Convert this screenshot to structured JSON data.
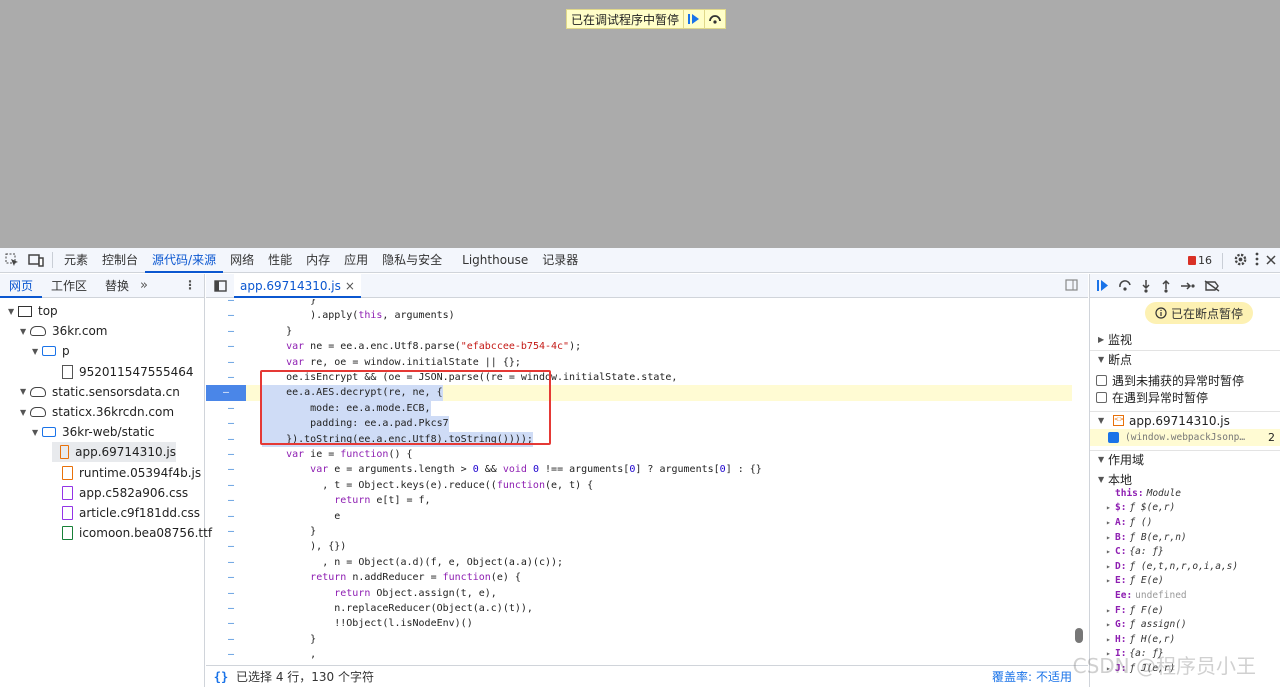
{
  "banner": {
    "text": "已在调试程序中暂停"
  },
  "toolbar": {
    "tabs": [
      "元素",
      "控制台",
      "源代码/来源",
      "网络",
      "性能",
      "内存",
      "应用",
      "隐私与安全",
      "Lighthouse",
      "记录器"
    ],
    "active_tab": "源代码/来源",
    "issues_count": "16"
  },
  "navigator": {
    "tabs": [
      "网页",
      "工作区",
      "替换"
    ],
    "tree": [
      {
        "label": "top",
        "kind": "top",
        "depth": 0
      },
      {
        "label": "36kr.com",
        "kind": "cloud",
        "depth": 1
      },
      {
        "label": "p",
        "kind": "folder",
        "depth": 2
      },
      {
        "label": "952011547555464",
        "kind": "doc",
        "depth": 3
      },
      {
        "label": "static.sensorsdata.cn",
        "kind": "cloud",
        "depth": 1
      },
      {
        "label": "staticx.36krcdn.com",
        "kind": "cloud",
        "depth": 1
      },
      {
        "label": "36kr-web/static",
        "kind": "folder",
        "depth": 2
      },
      {
        "label": "app.69714310.js",
        "kind": "js",
        "depth": 3
      },
      {
        "label": "runtime.05394f4b.js",
        "kind": "js",
        "depth": 3
      },
      {
        "label": "app.c582a906.css",
        "kind": "css",
        "depth": 3
      },
      {
        "label": "article.c9f181dd.css",
        "kind": "css",
        "depth": 3
      },
      {
        "label": "icomoon.bea08756.ttf",
        "kind": "font",
        "depth": 3
      }
    ]
  },
  "editor": {
    "tab": "app.69714310.js",
    "lines": [
      "        }",
      "        ).apply(this, arguments)",
      "    }",
      "    var ne = ee.a.enc.Utf8.parse(\"efabccee-b754-4c\");",
      "    var re, oe = window.initialState || {};",
      "    oe.isEncrypt && (oe = JSON.parse((re = window.initialState.state,",
      "    ee.a.AES.decrypt(re, ne, {",
      "        mode: ee.a.mode.ECB,",
      "        padding: ee.a.pad.Pkcs7",
      "    }).toString(ee.a.enc.Utf8).toString())));",
      "    var ie = function() {",
      "        var e = arguments.length > 0 && void 0 !== arguments[0] ? arguments[0] : {}",
      "          , t = Object.keys(e).reduce((function(e, t) {",
      "            return e[t] = f,",
      "            e",
      "        }",
      "        ), {})",
      "          , n = Object(a.d)(f, e, Object(a.a)(c));",
      "        return n.addReducer = function(e) {",
      "            return Object.assign(t, e),",
      "            n.replaceReducer(Object(a.c)(t)),",
      "            !!Object(l.isNodeEnv)()",
      "        }",
      "        ,"
    ],
    "status": "已选择 4 行，130 个字符",
    "coverage_label": "覆盖率:",
    "coverage_value": "不适用"
  },
  "debugger": {
    "paused_label": "已在断点暂停",
    "watch": "监视",
    "breakpoints": "断点",
    "pause_uncaught": "遇到未捕获的异常时暂停",
    "pause_caught": "在遇到异常时暂停",
    "bp_file": "app.69714310.js",
    "bp_snippet": "(window.webpackJsonp…",
    "bp_line": "2",
    "scope": "作用域",
    "local": "本地",
    "scope_items": [
      {
        "k": "this:",
        "v": "Module"
      },
      {
        "k": "$:",
        "v": "ƒ $(e,r)"
      },
      {
        "k": "A:",
        "v": "ƒ ()"
      },
      {
        "k": "B:",
        "v": "ƒ B(e,r,n)"
      },
      {
        "k": "C:",
        "v": "{a: ƒ}"
      },
      {
        "k": "D:",
        "v": "ƒ (e,t,n,r,o,i,a,s)"
      },
      {
        "k": "E:",
        "v": "ƒ E(e)"
      },
      {
        "k": "Ee:",
        "v": "undefined"
      },
      {
        "k": "F:",
        "v": "ƒ F(e)"
      },
      {
        "k": "G:",
        "v": "ƒ assign()"
      },
      {
        "k": "H:",
        "v": "ƒ H(e,r)"
      },
      {
        "k": "I:",
        "v": "{a: ƒ}"
      },
      {
        "k": "J:",
        "v": "ƒ J(e,r)"
      }
    ]
  },
  "watermark": "CSDN @程序员小王"
}
